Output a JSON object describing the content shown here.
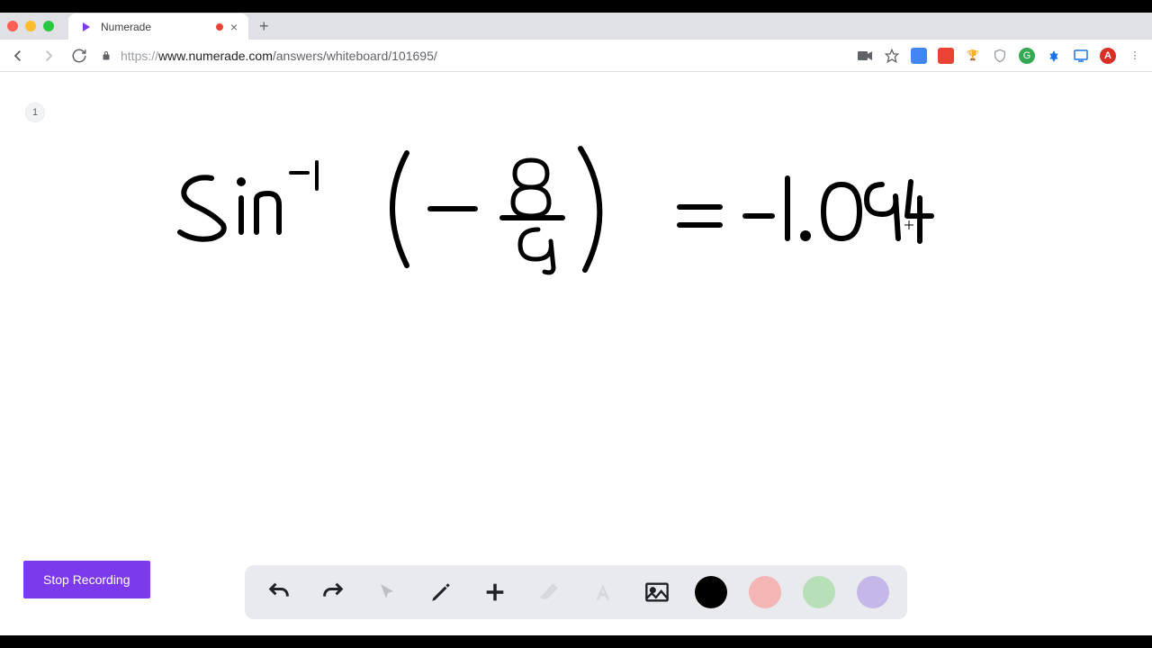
{
  "tab": {
    "title": "Numerade"
  },
  "url": {
    "protocol": "https://",
    "domain": "www.numerade.com",
    "path": "/answers/whiteboard/101695/"
  },
  "page_number": "1",
  "handwriting": {
    "expression": "sin⁻¹(−8/9) = −1.094",
    "parts": {
      "fn": "Sin",
      "sup": "-1",
      "lp": "(",
      "neg": "—",
      "num": "8",
      "den": "9",
      "rp": ")",
      "eq": "=",
      "r_neg": "−",
      "r_int": "1",
      "r_dot": ".",
      "r_dec": "094"
    }
  },
  "stop_button": "Stop Recording",
  "toolbar": {
    "undo": "Undo",
    "redo": "Redo",
    "pointer": "Pointer",
    "pen": "Pen",
    "add": "Add",
    "eraser": "Eraser",
    "text": "Text",
    "image": "Image"
  },
  "colors": {
    "black": "#000000",
    "pink": "#f4b5b5",
    "green": "#b8e0b8",
    "purple": "#c5b8e8"
  }
}
